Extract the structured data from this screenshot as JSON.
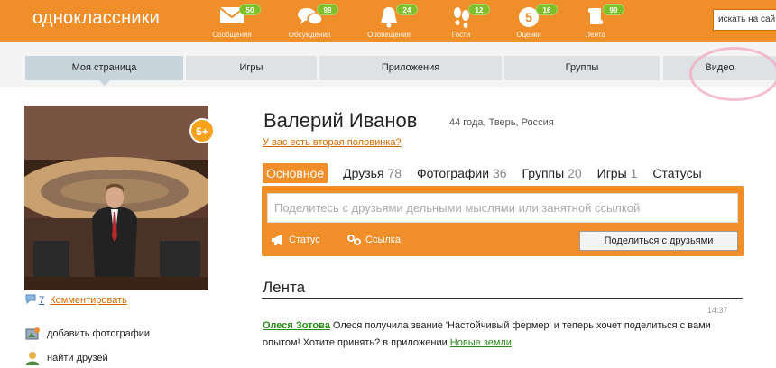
{
  "header": {
    "logo": "одноклассники",
    "nav": [
      {
        "label": "Сообщения",
        "badge": "50",
        "icon": "envelope-icon"
      },
      {
        "label": "Обсуждения",
        "badge": "99",
        "icon": "chat-bubbles-icon"
      },
      {
        "label": "Оповещения",
        "badge": "24",
        "icon": "bell-icon"
      },
      {
        "label": "Гости",
        "badge": "12",
        "icon": "footprints-icon"
      },
      {
        "label": "Оценки",
        "badge": "16",
        "icon": "rating-five-icon"
      },
      {
        "label": "Лента",
        "badge": "99",
        "icon": "feed-icon"
      }
    ],
    "search_text": "искать на сай"
  },
  "tabs": [
    {
      "label": "Моя страница",
      "active": true
    },
    {
      "label": "Игры"
    },
    {
      "label": "Приложения"
    },
    {
      "label": "Группы"
    },
    {
      "label": "Видео"
    }
  ],
  "profile": {
    "name": "Валерий Иванов",
    "meta": "44 года, Тверь, Россия",
    "half_link": "У вас есть вторая половинка?",
    "comment_count": "7",
    "comment_link": "Комментировать",
    "plus_badge": "5+",
    "actions": [
      {
        "label": "добавить фотографии",
        "icon": "add-photo-icon"
      },
      {
        "label": "найти друзей",
        "icon": "find-friends-icon"
      }
    ]
  },
  "subtabs": [
    {
      "label": "Основное",
      "count": "",
      "active": true
    },
    {
      "label": "Друзья",
      "count": "78"
    },
    {
      "label": "Фотографии",
      "count": "36"
    },
    {
      "label": "Группы",
      "count": "20"
    },
    {
      "label": "Игры",
      "count": "1"
    },
    {
      "label": "Статусы",
      "count": ""
    }
  ],
  "share": {
    "placeholder": "Поделитесь с друзьями дельными мыслями или занятной ссылкой",
    "status_label": "Статус",
    "link_label": "Ссылка",
    "button": "Поделиться с друзьями"
  },
  "feed": {
    "title": "Лента",
    "time": "14:37",
    "author": "Олеся Зотова",
    "text": " Олеся получила звание 'Настойчивый фермер' и теперь хочет поделиться с вами опытом! Хотите принять? в приложении ",
    "app": "Новые земли"
  },
  "colors": {
    "brand": "#f08e2a",
    "badge": "#7fbf2a",
    "link": "#d56b00",
    "author": "#2a8a1a"
  }
}
